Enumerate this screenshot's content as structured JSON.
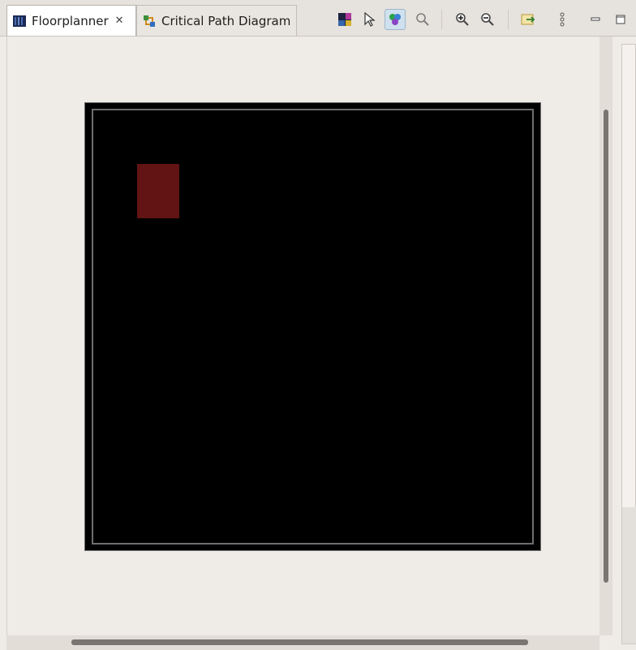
{
  "tabs": [
    {
      "label": "Floorplanner",
      "close_icon": "close-icon",
      "active": true,
      "icon": "floorplanner-icon"
    },
    {
      "label": "Critical Path Diagram",
      "active": false,
      "icon": "critical-path-icon"
    }
  ],
  "toolbar": {
    "buttons": [
      {
        "icon": "floorplanner-color-icon"
      },
      {
        "icon": "select-arrow-icon"
      },
      {
        "icon": "color-nodes-icon",
        "active": true
      },
      {
        "icon": "search-icon"
      },
      {
        "icon": "zoom-in-icon"
      },
      {
        "icon": "zoom-out-icon"
      },
      {
        "icon": "export-icon"
      },
      {
        "icon": "more-options-icon"
      },
      {
        "icon": "minimize-icon"
      },
      {
        "icon": "maximize-icon"
      }
    ]
  },
  "colors": {
    "die_background": "#000000",
    "block_fill": "#621313",
    "die_border": "#6e6e6e"
  }
}
